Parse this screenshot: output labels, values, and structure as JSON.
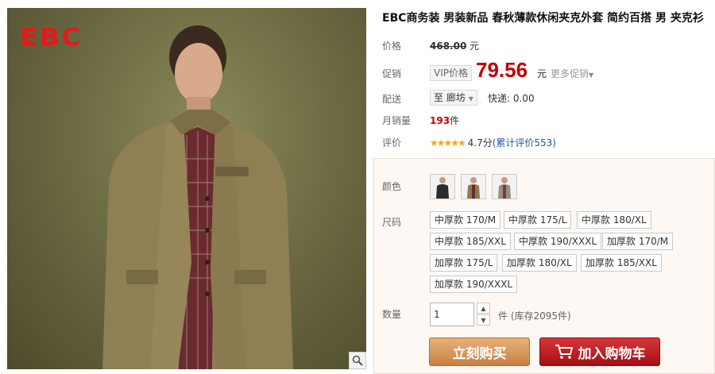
{
  "product": {
    "brand_logo": "EBC",
    "title": "EBC商务装 男装新品 春秋薄款休闲夹克外套 简约百搭 男 夹克衫"
  },
  "labels": {
    "price": "价格",
    "promo": "促销",
    "shipping": "配送",
    "monthly_sales": "月销量",
    "rating": "评价",
    "color": "颜色",
    "size": "尺码",
    "quantity": "数量"
  },
  "price": {
    "original": "468.00",
    "currency_unit": "元",
    "vip_label": "VIP价格",
    "sale": "79.56",
    "more_promos": "更多促销"
  },
  "shipping": {
    "destination_prefix": "至",
    "destination": "廊坊",
    "express": "快递: 0.00"
  },
  "sales": {
    "monthly_count": "193",
    "unit": "件"
  },
  "rating": {
    "stars": "★★★★★",
    "score": "4.7分",
    "reviews": "(累计评价553)"
  },
  "colors": [
    {
      "name": "black-jacket",
      "swatch": "#2b2b2b"
    },
    {
      "name": "khaki-jacket",
      "swatch": "#8a7a52"
    },
    {
      "name": "grey-jacket",
      "swatch": "#9a8f7c"
    }
  ],
  "sizes": [
    "中厚款 170/M",
    "中厚款 175/L",
    "中厚款 180/XL",
    "中厚款 185/XXL",
    "中厚款 190/XXXL",
    "加厚款 170/M",
    "加厚款 175/L",
    "加厚款 180/XL",
    "加厚款 185/XXL",
    "加厚款 190/XXXL"
  ],
  "quantity": {
    "value": "1",
    "stock": "件 (库存2095件)"
  },
  "actions": {
    "buy_now": "立刻购买",
    "add_to_cart": "加入购物车"
  },
  "colors_theme": {
    "price_red": "#c40000",
    "buy_orange": "#d18c4a",
    "cart_red": "#b81c20",
    "link_blue": "#1f58a8"
  }
}
